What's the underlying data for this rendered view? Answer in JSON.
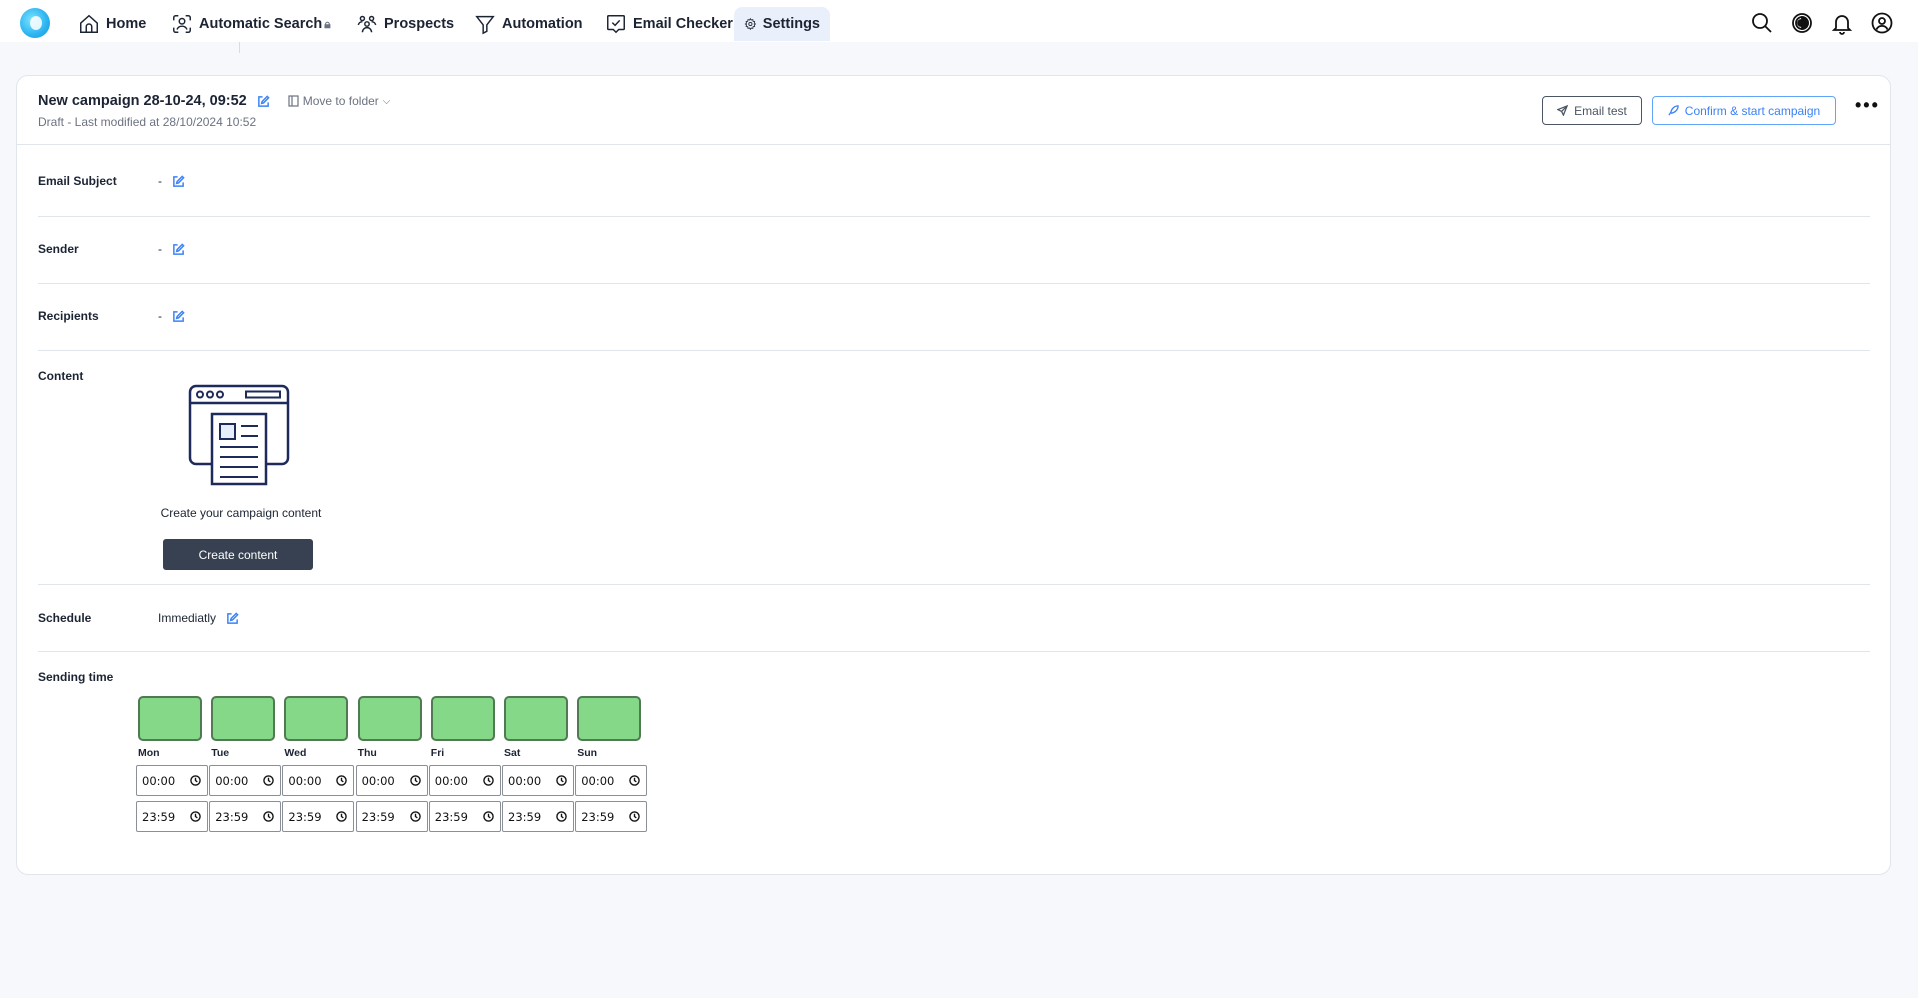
{
  "nav": {
    "items": [
      {
        "label": "Home",
        "icon": "home-icon"
      },
      {
        "label": "Automatic Search",
        "icon": "face-scan-icon",
        "locked": true
      },
      {
        "label": "Prospects",
        "icon": "users-icon"
      },
      {
        "label": "Automation",
        "icon": "filter-icon"
      },
      {
        "label": "Email Checker",
        "icon": "message-check-icon"
      },
      {
        "label": "Settings",
        "icon": "gear-icon",
        "active": true
      }
    ],
    "right_icons": [
      "search-icon",
      "theme-toggle-icon",
      "bell-icon",
      "user-circle-icon"
    ]
  },
  "campaign": {
    "title": "New campaign 28-10-24, 09:52",
    "move_to_folder": "Move to folder",
    "status_line": "Draft - Last modified at 28/10/2024 10:52",
    "email_test_label": "Email test",
    "confirm_label": "Confirm & start campaign",
    "more_label": "•••"
  },
  "fields": {
    "email_subject": {
      "label": "Email Subject",
      "value": "-"
    },
    "sender": {
      "label": "Sender",
      "value": "-"
    },
    "recipients": {
      "label": "Recipients",
      "value": "-"
    },
    "content": {
      "label": "Content",
      "caption": "Create your campaign content",
      "button": "Create content"
    },
    "schedule": {
      "label": "Schedule",
      "value": "Immediatly"
    },
    "sending_time": {
      "label": "Sending time"
    }
  },
  "days": [
    {
      "label": "Mon",
      "enabled": true,
      "start": "00:00",
      "end": "23:59"
    },
    {
      "label": "Tue",
      "enabled": true,
      "start": "00:00",
      "end": "23:59"
    },
    {
      "label": "Wed",
      "enabled": true,
      "start": "00:00",
      "end": "23:59"
    },
    {
      "label": "Thu",
      "enabled": true,
      "start": "00:00",
      "end": "23:59"
    },
    {
      "label": "Fri",
      "enabled": true,
      "start": "00:00",
      "end": "23:59"
    },
    {
      "label": "Sat",
      "enabled": true,
      "start": "00:00",
      "end": "23:59"
    },
    {
      "label": "Sun",
      "enabled": true,
      "start": "00:00",
      "end": "23:59"
    }
  ],
  "colors": {
    "accent": "#3b82f6",
    "day_enabled": "#84d887",
    "primary_button": "#374151"
  }
}
